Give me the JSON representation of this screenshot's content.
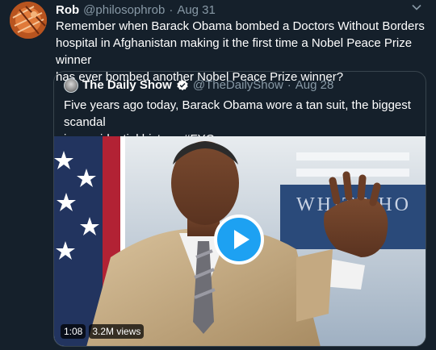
{
  "tweet": {
    "author_name": "Rob",
    "author_handle": "@philosophrob",
    "separator": "·",
    "date": "Aug 31",
    "more_icon": "ellipsis-icon",
    "text_lines": [
      "Remember when Barack Obama bombed a Doctors Without Borders",
      "hospital in Afghanistan making it the first time a Nobel Peace Prize winner",
      "has ever bombed another Nobel Peace Prize winner?"
    ]
  },
  "quoted_tweet": {
    "author_name": "The Daily Show",
    "verified_icon": "verified-badge-icon",
    "author_handle": "@TheDailyShow",
    "separator": "·",
    "date": "Aug 28",
    "text_lines": [
      "Five years ago today, Barack Obama wore a tan suit, the biggest scandal",
      "in presidential history. #FYC"
    ],
    "video": {
      "duration": "1:08",
      "views": "3.2M views",
      "play_icon": "play-icon"
    }
  },
  "colors": {
    "background": "#15202b",
    "text": "#ffffff",
    "secondary_text": "#8899a6",
    "border": "#38444d",
    "accent": "#1da1f2"
  }
}
